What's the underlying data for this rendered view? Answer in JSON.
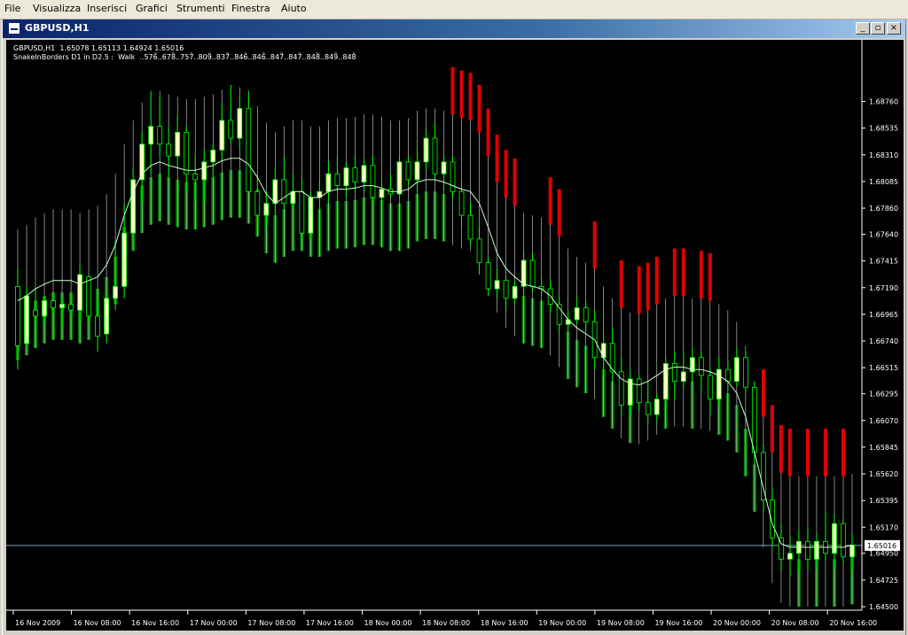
{
  "menu": {
    "items": [
      {
        "id": "file",
        "label": "File"
      },
      {
        "id": "visualizza",
        "label": "Visualizza"
      },
      {
        "id": "inserisci",
        "label": "Inserisci"
      },
      {
        "id": "grafici",
        "label": "Grafici"
      },
      {
        "id": "strumenti",
        "label": "Strumenti"
      },
      {
        "id": "finestra",
        "label": "Finestra"
      },
      {
        "id": "aiuto",
        "label": "Aiuto"
      }
    ]
  },
  "window": {
    "title": "GBPUSD,H1",
    "minimize_label": "_",
    "restore_label": "▫",
    "close_label": "×"
  },
  "chart_info": {
    "ohlc_line": "GBPUSD,H1  1.65078 1.65113 1.64924 1.65016",
    "indicator_line": "SnakeInBorders D1 in D2.5 :  Walk  ..576̃..678̃..757̃..809̃..837̃..846̃..846̃..847̃..847̃..848̃..849̃..848̃"
  },
  "colors": {
    "background": "#000000",
    "axis": "#ffffff",
    "bull_candle": "#ffffc0",
    "bear_candle": "#000000",
    "candle_outline": "#00ff00",
    "band_green": "#008000",
    "band_red": "#e00000",
    "snake_line": "#ccffcc",
    "price_line": "#8ca0b4"
  },
  "chart_data": {
    "type": "candlestick",
    "symbol": "GBPUSD",
    "timeframe": "H1",
    "ylim": [
      1.645,
      1.691
    ],
    "y_ticks": [
      "1.68760",
      "1.68535",
      "1.68310",
      "1.68085",
      "1.67860",
      "1.67640",
      "1.67415",
      "1.67190",
      "1.66965",
      "1.66740",
      "1.66515",
      "1.66295",
      "1.66070",
      "1.65845",
      "1.65620",
      "1.65395",
      "1.65170",
      "1.64950",
      "1.64725",
      "1.64500"
    ],
    "x_labels": [
      "16 Nov 2009",
      "16 Nov 08:00",
      "16 Nov 16:00",
      "17 Nov 00:00",
      "17 Nov 08:00",
      "17 Nov 16:00",
      "18 Nov 00:00",
      "18 Nov 08:00",
      "18 Nov 16:00",
      "19 Nov 00:00",
      "19 Nov 08:00",
      "19 Nov 16:00",
      "20 Nov 00:00",
      "20 Nov 08:00",
      "20 Nov 16:00"
    ],
    "current_price": "1.65016",
    "snake_center": [
      1.6708,
      1.6712,
      1.6718,
      1.6722,
      1.6725,
      1.6725,
      1.6725,
      1.6722,
      1.6725,
      1.6728,
      1.6738,
      1.6755,
      1.678,
      1.68,
      1.6815,
      1.6822,
      1.6825,
      1.6822,
      1.682,
      1.6818,
      1.6818,
      1.682,
      1.6822,
      1.6826,
      1.6828,
      1.6828,
      1.6823,
      1.6812,
      1.6798,
      1.679,
      1.6795,
      1.68,
      1.68,
      1.6795,
      1.6795,
      1.68,
      1.6802,
      1.6802,
      1.6803,
      1.6805,
      1.6805,
      1.6803,
      1.68,
      1.68,
      1.6802,
      1.6808,
      1.681,
      1.681,
      1.6808,
      1.6805,
      1.6802,
      1.68,
      1.679,
      1.677,
      1.6748,
      1.6735,
      1.6728,
      1.6722,
      1.672,
      1.6718,
      1.6712,
      1.6702,
      1.6692,
      1.6685,
      1.668,
      1.6675,
      1.666,
      1.665,
      1.6642,
      1.6638,
      1.6637,
      1.664,
      1.6645,
      1.665,
      1.6652,
      1.6652,
      1.665,
      1.665,
      1.6648,
      1.6645,
      1.664,
      1.663,
      1.661,
      1.658,
      1.655,
      1.652,
      1.6503,
      1.65,
      1.65,
      1.65,
      1.65,
      1.65,
      1.65,
      1.65,
      1.6502
    ],
    "candles": [
      {
        "o": 1.672,
        "h": 1.6735,
        "l": 1.665,
        "c": 1.667
      },
      {
        "o": 1.6672,
        "h": 1.672,
        "l": 1.6668,
        "c": 1.6712
      },
      {
        "o": 1.67,
        "h": 1.6718,
        "l": 1.669,
        "c": 1.6695
      },
      {
        "o": 1.6695,
        "h": 1.6712,
        "l": 1.6688,
        "c": 1.6708
      },
      {
        "o": 1.6708,
        "h": 1.6715,
        "l": 1.6698,
        "c": 1.6702
      },
      {
        "o": 1.6702,
        "h": 1.671,
        "l": 1.6685,
        "c": 1.6705
      },
      {
        "o": 1.6705,
        "h": 1.6715,
        "l": 1.6695,
        "c": 1.67
      },
      {
        "o": 1.67,
        "h": 1.6738,
        "l": 1.669,
        "c": 1.673
      },
      {
        "o": 1.6728,
        "h": 1.673,
        "l": 1.669,
        "c": 1.6695
      },
      {
        "o": 1.6695,
        "h": 1.6708,
        "l": 1.6665,
        "c": 1.6678
      },
      {
        "o": 1.668,
        "h": 1.6715,
        "l": 1.6672,
        "c": 1.671
      },
      {
        "o": 1.671,
        "h": 1.676,
        "l": 1.67,
        "c": 1.672
      },
      {
        "o": 1.672,
        "h": 1.679,
        "l": 1.671,
        "c": 1.6765
      },
      {
        "o": 1.6765,
        "h": 1.682,
        "l": 1.6755,
        "c": 1.681
      },
      {
        "o": 1.681,
        "h": 1.685,
        "l": 1.679,
        "c": 1.684
      },
      {
        "o": 1.684,
        "h": 1.6885,
        "l": 1.6815,
        "c": 1.6855
      },
      {
        "o": 1.6855,
        "h": 1.688,
        "l": 1.683,
        "c": 1.684
      },
      {
        "o": 1.684,
        "h": 1.6855,
        "l": 1.681,
        "c": 1.683
      },
      {
        "o": 1.683,
        "h": 1.6865,
        "l": 1.682,
        "c": 1.685
      },
      {
        "o": 1.685,
        "h": 1.6855,
        "l": 1.68,
        "c": 1.6815
      },
      {
        "o": 1.6815,
        "h": 1.683,
        "l": 1.6795,
        "c": 1.681
      },
      {
        "o": 1.681,
        "h": 1.6835,
        "l": 1.679,
        "c": 1.6825
      },
      {
        "o": 1.6825,
        "h": 1.684,
        "l": 1.681,
        "c": 1.6835
      },
      {
        "o": 1.6835,
        "h": 1.6875,
        "l": 1.6825,
        "c": 1.686
      },
      {
        "o": 1.686,
        "h": 1.689,
        "l": 1.684,
        "c": 1.6845
      },
      {
        "o": 1.6845,
        "h": 1.688,
        "l": 1.6835,
        "c": 1.687
      },
      {
        "o": 1.687,
        "h": 1.6885,
        "l": 1.684,
        "c": 1.68
      },
      {
        "o": 1.68,
        "h": 1.6815,
        "l": 1.677,
        "c": 1.678
      },
      {
        "o": 1.678,
        "h": 1.68,
        "l": 1.677,
        "c": 1.679
      },
      {
        "o": 1.679,
        "h": 1.682,
        "l": 1.678,
        "c": 1.681
      },
      {
        "o": 1.681,
        "h": 1.683,
        "l": 1.6785,
        "c": 1.679
      },
      {
        "o": 1.679,
        "h": 1.6815,
        "l": 1.6785,
        "c": 1.68
      },
      {
        "o": 1.68,
        "h": 1.681,
        "l": 1.676,
        "c": 1.6765
      },
      {
        "o": 1.6765,
        "h": 1.68,
        "l": 1.676,
        "c": 1.6795
      },
      {
        "o": 1.6795,
        "h": 1.681,
        "l": 1.6785,
        "c": 1.68
      },
      {
        "o": 1.68,
        "h": 1.6825,
        "l": 1.679,
        "c": 1.6815
      },
      {
        "o": 1.6815,
        "h": 1.683,
        "l": 1.68,
        "c": 1.6805
      },
      {
        "o": 1.6805,
        "h": 1.6825,
        "l": 1.6795,
        "c": 1.682
      },
      {
        "o": 1.682,
        "h": 1.683,
        "l": 1.68,
        "c": 1.6808
      },
      {
        "o": 1.6808,
        "h": 1.6828,
        "l": 1.68,
        "c": 1.6822
      },
      {
        "o": 1.6822,
        "h": 1.683,
        "l": 1.679,
        "c": 1.6795
      },
      {
        "o": 1.6795,
        "h": 1.681,
        "l": 1.6788,
        "c": 1.6802
      },
      {
        "o": 1.6802,
        "h": 1.6815,
        "l": 1.6795,
        "c": 1.6798
      },
      {
        "o": 1.6798,
        "h": 1.683,
        "l": 1.6795,
        "c": 1.6825
      },
      {
        "o": 1.6825,
        "h": 1.683,
        "l": 1.6805,
        "c": 1.681
      },
      {
        "o": 1.681,
        "h": 1.6835,
        "l": 1.68,
        "c": 1.6825
      },
      {
        "o": 1.6825,
        "h": 1.6852,
        "l": 1.6818,
        "c": 1.6845
      },
      {
        "o": 1.6845,
        "h": 1.6858,
        "l": 1.681,
        "c": 1.6815
      },
      {
        "o": 1.6815,
        "h": 1.683,
        "l": 1.68,
        "c": 1.6825
      },
      {
        "o": 1.6825,
        "h": 1.683,
        "l": 1.6795,
        "c": 1.68
      },
      {
        "o": 1.68,
        "h": 1.681,
        "l": 1.677,
        "c": 1.678
      },
      {
        "o": 1.678,
        "h": 1.679,
        "l": 1.6755,
        "c": 1.676
      },
      {
        "o": 1.676,
        "h": 1.677,
        "l": 1.673,
        "c": 1.674
      },
      {
        "o": 1.674,
        "h": 1.6745,
        "l": 1.6712,
        "c": 1.6718
      },
      {
        "o": 1.6718,
        "h": 1.6735,
        "l": 1.671,
        "c": 1.6725
      },
      {
        "o": 1.6725,
        "h": 1.6728,
        "l": 1.67,
        "c": 1.671
      },
      {
        "o": 1.671,
        "h": 1.6725,
        "l": 1.6705,
        "c": 1.672
      },
      {
        "o": 1.672,
        "h": 1.675,
        "l": 1.6712,
        "c": 1.6742
      },
      {
        "o": 1.6742,
        "h": 1.6748,
        "l": 1.6715,
        "c": 1.672
      },
      {
        "o": 1.672,
        "h": 1.6728,
        "l": 1.6712,
        "c": 1.6718
      },
      {
        "o": 1.6718,
        "h": 1.6725,
        "l": 1.6698,
        "c": 1.6705
      },
      {
        "o": 1.6705,
        "h": 1.6712,
        "l": 1.668,
        "c": 1.6688
      },
      {
        "o": 1.6688,
        "h": 1.67,
        "l": 1.6682,
        "c": 1.6692
      },
      {
        "o": 1.6692,
        "h": 1.6712,
        "l": 1.6688,
        "c": 1.6702
      },
      {
        "o": 1.6702,
        "h": 1.6708,
        "l": 1.668,
        "c": 1.669
      },
      {
        "o": 1.669,
        "h": 1.67,
        "l": 1.665,
        "c": 1.666
      },
      {
        "o": 1.666,
        "h": 1.668,
        "l": 1.6645,
        "c": 1.6672
      },
      {
        "o": 1.6672,
        "h": 1.6685,
        "l": 1.664,
        "c": 1.6648
      },
      {
        "o": 1.6648,
        "h": 1.666,
        "l": 1.661,
        "c": 1.662
      },
      {
        "o": 1.662,
        "h": 1.665,
        "l": 1.6612,
        "c": 1.6642
      },
      {
        "o": 1.6642,
        "h": 1.6645,
        "l": 1.6615,
        "c": 1.6622
      },
      {
        "o": 1.6622,
        "h": 1.664,
        "l": 1.6605,
        "c": 1.6612
      },
      {
        "o": 1.6612,
        "h": 1.663,
        "l": 1.6605,
        "c": 1.6625
      },
      {
        "o": 1.6625,
        "h": 1.666,
        "l": 1.662,
        "c": 1.6655
      },
      {
        "o": 1.6655,
        "h": 1.6665,
        "l": 1.6625,
        "c": 1.664
      },
      {
        "o": 1.664,
        "h": 1.6665,
        "l": 1.6635,
        "c": 1.6648
      },
      {
        "o": 1.6648,
        "h": 1.6668,
        "l": 1.664,
        "c": 1.666
      },
      {
        "o": 1.666,
        "h": 1.6665,
        "l": 1.663,
        "c": 1.6645
      },
      {
        "o": 1.6645,
        "h": 1.6652,
        "l": 1.661,
        "c": 1.6625
      },
      {
        "o": 1.6625,
        "h": 1.666,
        "l": 1.662,
        "c": 1.665
      },
      {
        "o": 1.665,
        "h": 1.6658,
        "l": 1.6632,
        "c": 1.664
      },
      {
        "o": 1.664,
        "h": 1.6668,
        "l": 1.6635,
        "c": 1.666
      },
      {
        "o": 1.666,
        "h": 1.6665,
        "l": 1.663,
        "c": 1.6635
      },
      {
        "o": 1.6635,
        "h": 1.664,
        "l": 1.657,
        "c": 1.658
      },
      {
        "o": 1.658,
        "h": 1.6588,
        "l": 1.653,
        "c": 1.654
      },
      {
        "o": 1.654,
        "h": 1.655,
        "l": 1.65,
        "c": 1.6508
      },
      {
        "o": 1.6508,
        "h": 1.652,
        "l": 1.648,
        "c": 1.649
      },
      {
        "o": 1.649,
        "h": 1.651,
        "l": 1.6475,
        "c": 1.6495
      },
      {
        "o": 1.6495,
        "h": 1.6515,
        "l": 1.6478,
        "c": 1.6505
      },
      {
        "o": 1.6505,
        "h": 1.6518,
        "l": 1.648,
        "c": 1.649
      },
      {
        "o": 1.649,
        "h": 1.6512,
        "l": 1.6482,
        "c": 1.6505
      },
      {
        "o": 1.6505,
        "h": 1.653,
        "l": 1.6488,
        "c": 1.6495
      },
      {
        "o": 1.6495,
        "h": 1.6528,
        "l": 1.6482,
        "c": 1.652
      },
      {
        "o": 1.652,
        "h": 1.6525,
        "l": 1.6485,
        "c": 1.6492
      },
      {
        "o": 1.6492,
        "h": 1.6512,
        "l": 1.648,
        "c": 1.6502
      }
    ]
  }
}
